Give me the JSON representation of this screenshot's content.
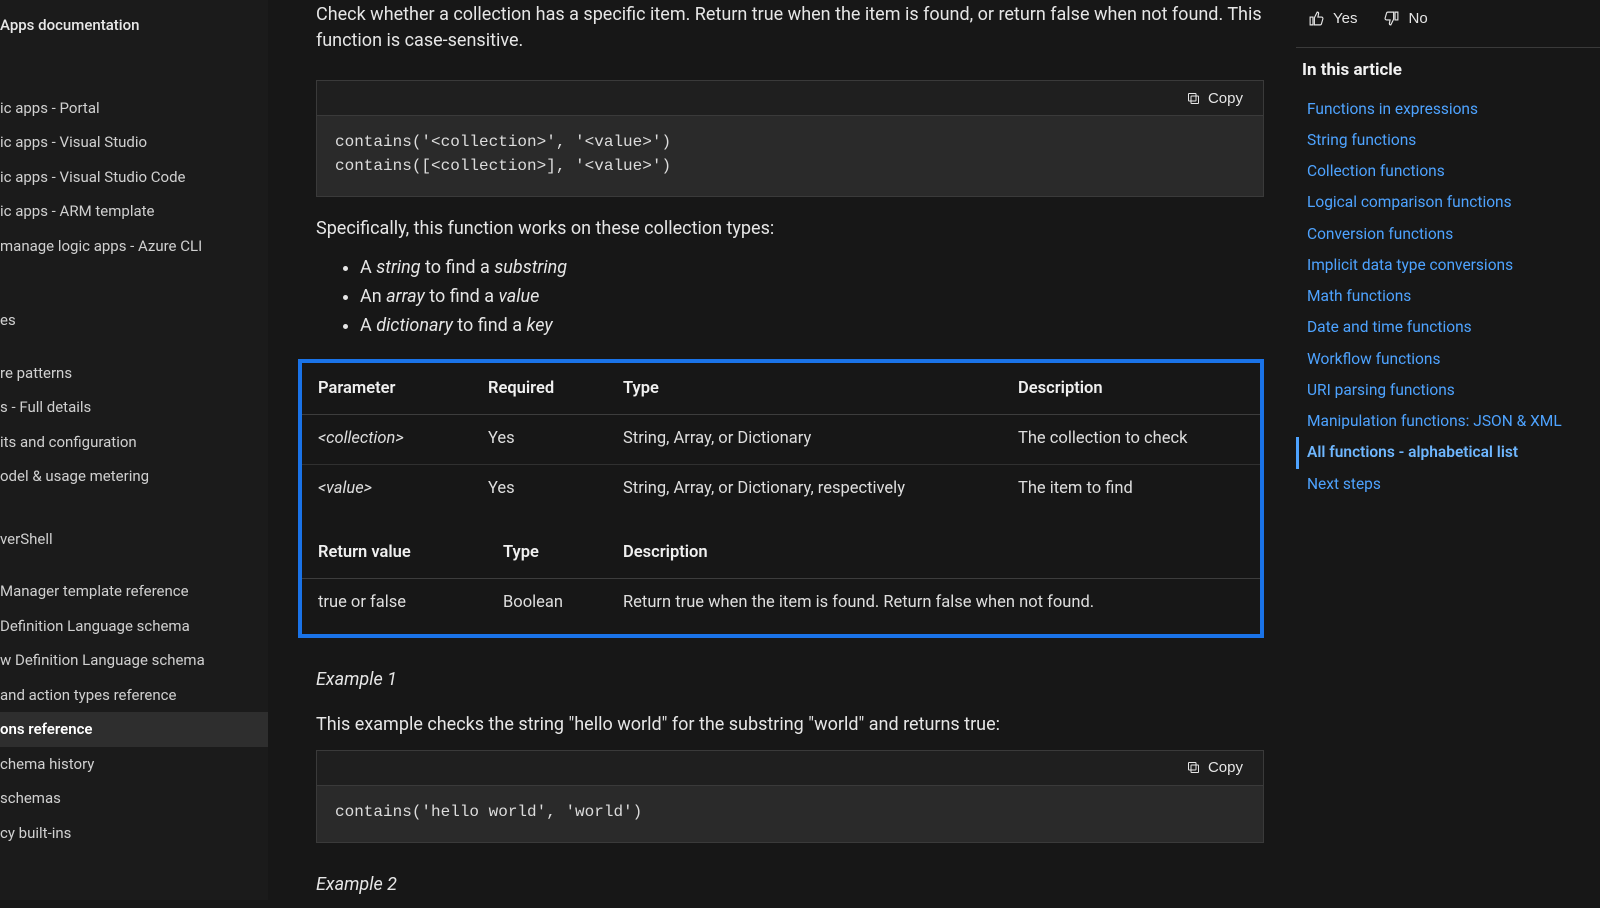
{
  "left_nav": {
    "top_title": "Apps documentation",
    "group1": [
      "ic apps - Portal",
      "ic apps - Visual Studio",
      "ic apps - Visual Studio Code",
      "ic apps - ARM template",
      " manage logic apps - Azure CLI"
    ],
    "group2_title": "es",
    "group2": [
      "re patterns",
      "s - Full details",
      "its and configuration",
      "odel & usage metering"
    ],
    "group3_title": "verShell",
    "group3": [
      "Manager template reference",
      "Definition Language schema",
      "w Definition Language schema",
      " and action types reference",
      "ons reference",
      "chema history",
      "schemas",
      "cy built-ins"
    ],
    "active_index": 4
  },
  "main": {
    "lead": "Check whether a collection has a specific item. Return true when the item is found, or return false when not found. This function is case-sensitive.",
    "copy_label": "Copy",
    "code1": "contains('<collection>', '<value>')\ncontains([<collection>], '<value>')",
    "specifically": "Specifically, this function works on these collection types:",
    "types_list": [
      {
        "pre": "A ",
        "em1": "string",
        "mid": " to find a ",
        "em2": "substring"
      },
      {
        "pre": "An ",
        "em1": "array",
        "mid": " to find a ",
        "em2": "value"
      },
      {
        "pre": "A ",
        "em1": "dictionary",
        "mid": " to find a ",
        "em2": "key"
      }
    ],
    "param_table": {
      "headers": [
        "Parameter",
        "Required",
        "Type",
        "Description"
      ],
      "rows": [
        {
          "p": "<collection>",
          "r": "Yes",
          "t": "String, Array, or Dictionary",
          "d": "The collection to check"
        },
        {
          "p": "<value>",
          "r": "Yes",
          "t": "String, Array, or Dictionary, respectively",
          "d": "The item to find"
        }
      ]
    },
    "return_table": {
      "headers": [
        "Return value",
        "Type",
        "Description"
      ],
      "rows": [
        {
          "rv": "true or false",
          "t": "Boolean",
          "d": "Return true when the item is found. Return false when not found."
        }
      ]
    },
    "example1_h": "Example 1",
    "example1_p": "This example checks the string \"hello world\" for the substring \"world\" and returns true:",
    "code2": "contains('hello world', 'world')",
    "example2_h": "Example 2"
  },
  "right": {
    "yes": "Yes",
    "no": "No",
    "in_article": "In this article",
    "toc": [
      "Functions in expressions",
      "String functions",
      "Collection functions",
      "Logical comparison functions",
      "Conversion functions",
      "Implicit data type conversions",
      "Math functions",
      "Date and time functions",
      "Workflow functions",
      "URI parsing functions",
      "Manipulation functions: JSON & XML",
      "All functions - alphabetical list",
      "Next steps"
    ],
    "active_index": 11
  }
}
